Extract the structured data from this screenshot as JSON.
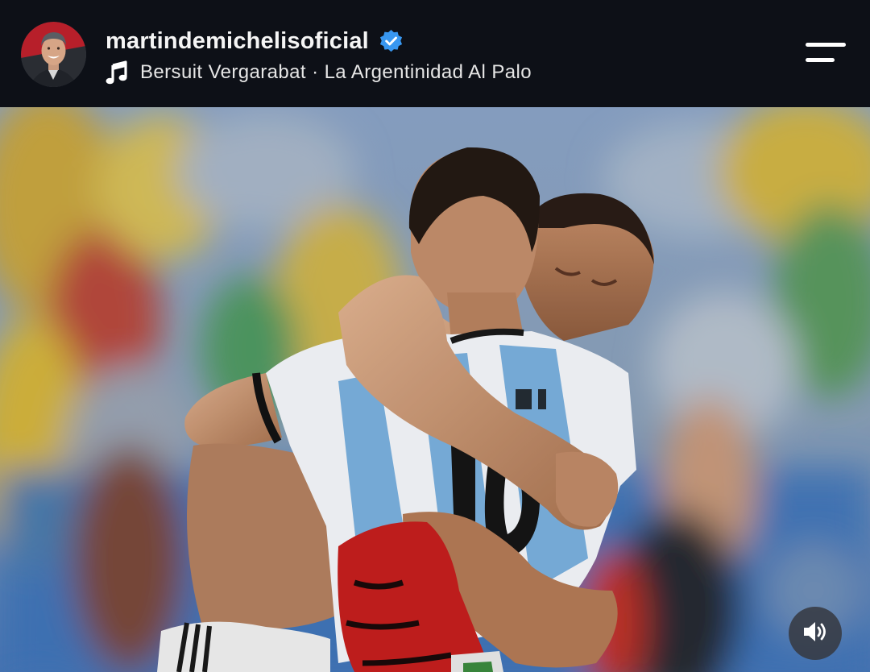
{
  "post": {
    "username": "martindemichelisoficial",
    "verified": true,
    "audio": {
      "artist": "Bersuit Vergarabat",
      "separator": "·",
      "title": "La Argentinidad Al Palo"
    }
  },
  "icons": {
    "verified": "verified-badge-icon",
    "music": "music-note-icon",
    "menu": "menu-icon",
    "sound": "speaker-volume-icon"
  },
  "colors": {
    "header_bg": "#0d1017",
    "verified_blue": "#3897f0",
    "text_primary": "#f5f5f5"
  }
}
